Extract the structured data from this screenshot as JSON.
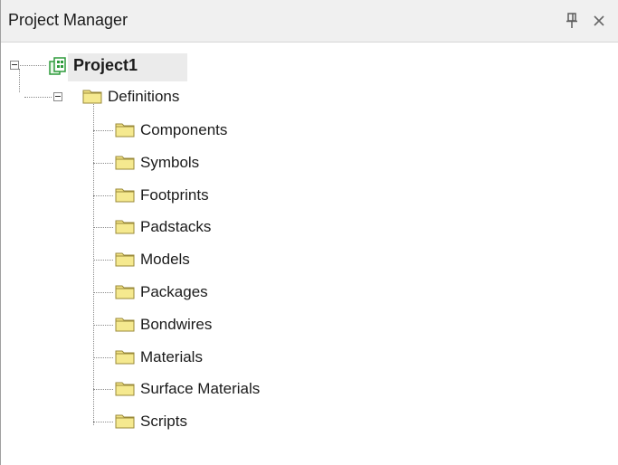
{
  "panel": {
    "title": "Project Manager",
    "pin_glyph": "㎖",
    "pin_icon": "pin-icon",
    "close_icon": "close-icon"
  },
  "tree": {
    "root": {
      "label": "Project1",
      "icon": "project-icon",
      "expanded": true
    },
    "definitions": {
      "label": "Definitions",
      "icon": "folder-icon",
      "expanded": true
    },
    "children": [
      {
        "label": "Components",
        "icon": "folder-icon"
      },
      {
        "label": "Symbols",
        "icon": "folder-icon"
      },
      {
        "label": "Footprints",
        "icon": "folder-icon"
      },
      {
        "label": "Padstacks",
        "icon": "folder-icon"
      },
      {
        "label": "Models",
        "icon": "folder-icon"
      },
      {
        "label": "Packages",
        "icon": "folder-icon"
      },
      {
        "label": "Bondwires",
        "icon": "folder-icon"
      },
      {
        "label": "Materials",
        "icon": "folder-icon"
      },
      {
        "label": "Surface Materials",
        "icon": "folder-icon"
      },
      {
        "label": "Scripts",
        "icon": "folder-icon"
      }
    ]
  },
  "colors": {
    "folder_fill": "#f2e284",
    "folder_border": "#9a8a3a",
    "project_green": "#2e9b3c"
  }
}
